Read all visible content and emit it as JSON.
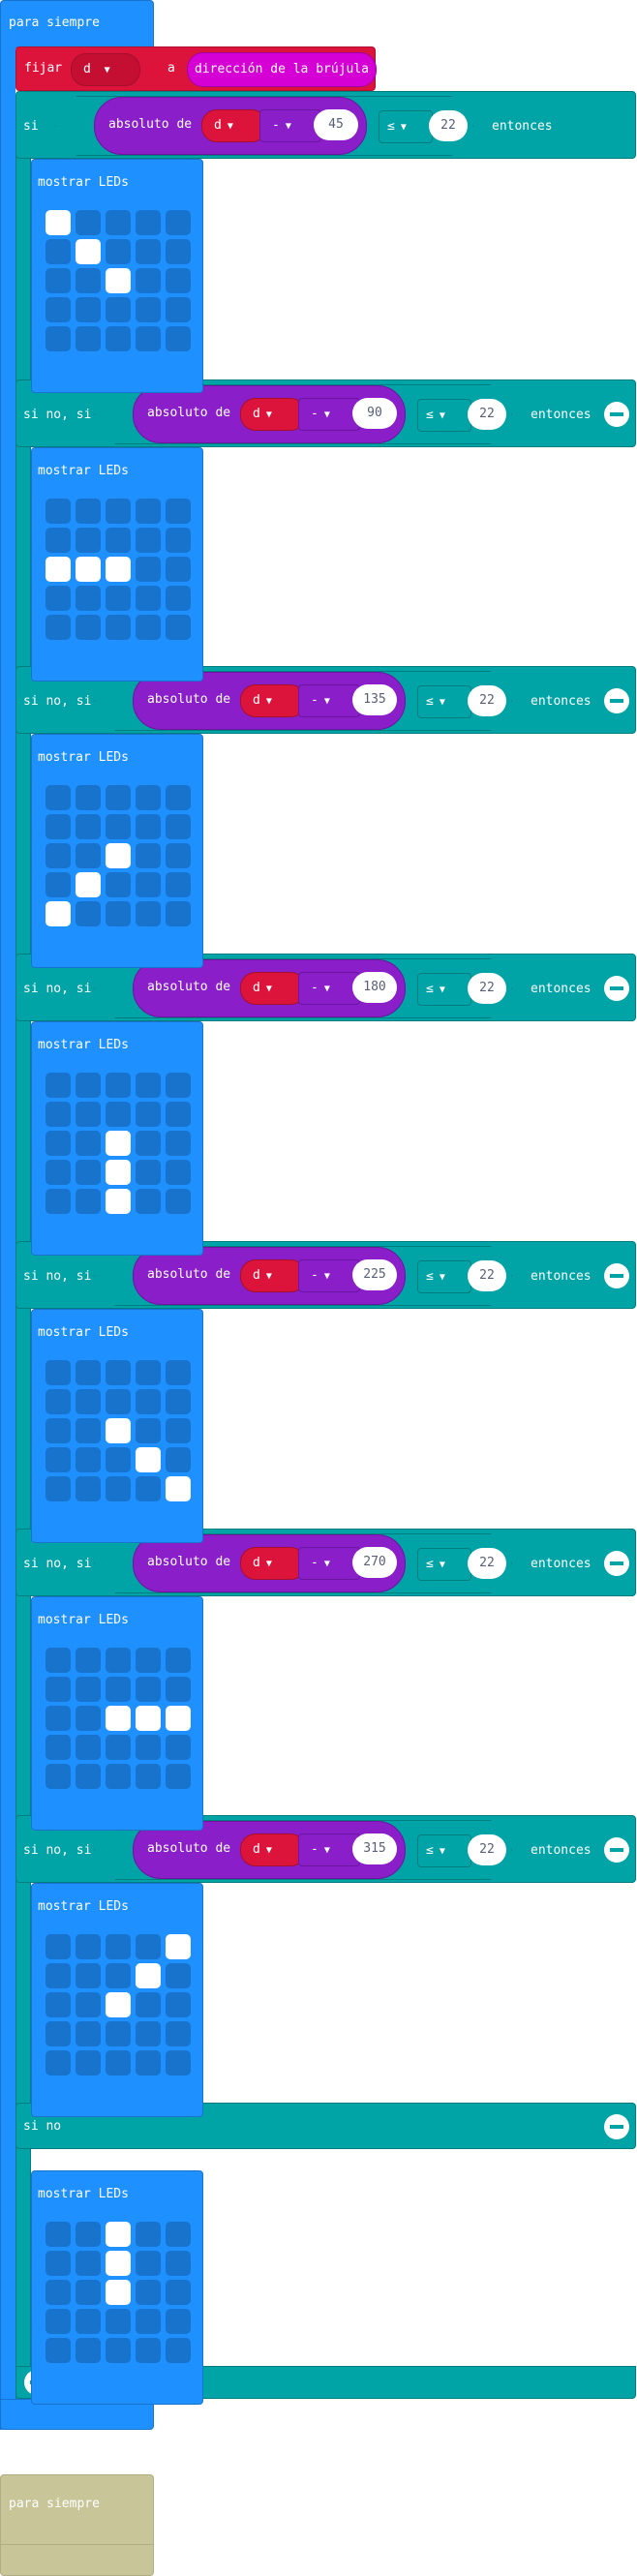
{
  "forever": {
    "label": "para siempre"
  },
  "set_block": {
    "label": "fijar",
    "variable": "d",
    "to_label": "a",
    "sensor_label": "dirección de la brújula (°)"
  },
  "if_keyword": "si",
  "elseif_keyword": "si no, si",
  "else_keyword": "si no",
  "then_keyword": "entonces",
  "condition": {
    "abs_label": "absoluto de",
    "variable": "d",
    "operator": "-",
    "compare_op": "≤",
    "threshold": "22"
  },
  "angles": [
    "45",
    "90",
    "135",
    "180",
    "225",
    "270",
    "315"
  ],
  "show_leds_label": "mostrar LEDs",
  "led_patterns": [
    [
      [
        1,
        0,
        0,
        0,
        0
      ],
      [
        0,
        1,
        0,
        0,
        0
      ],
      [
        0,
        0,
        1,
        0,
        0
      ],
      [
        0,
        0,
        0,
        0,
        0
      ],
      [
        0,
        0,
        0,
        0,
        0
      ]
    ],
    [
      [
        0,
        0,
        0,
        0,
        0
      ],
      [
        0,
        0,
        0,
        0,
        0
      ],
      [
        1,
        1,
        1,
        0,
        0
      ],
      [
        0,
        0,
        0,
        0,
        0
      ],
      [
        0,
        0,
        0,
        0,
        0
      ]
    ],
    [
      [
        0,
        0,
        0,
        0,
        0
      ],
      [
        0,
        0,
        0,
        0,
        0
      ],
      [
        0,
        0,
        1,
        0,
        0
      ],
      [
        0,
        1,
        0,
        0,
        0
      ],
      [
        1,
        0,
        0,
        0,
        0
      ]
    ],
    [
      [
        0,
        0,
        0,
        0,
        0
      ],
      [
        0,
        0,
        0,
        0,
        0
      ],
      [
        0,
        0,
        1,
        0,
        0
      ],
      [
        0,
        0,
        1,
        0,
        0
      ],
      [
        0,
        0,
        1,
        0,
        0
      ]
    ],
    [
      [
        0,
        0,
        0,
        0,
        0
      ],
      [
        0,
        0,
        0,
        0,
        0
      ],
      [
        0,
        0,
        1,
        0,
        0
      ],
      [
        0,
        0,
        0,
        1,
        0
      ],
      [
        0,
        0,
        0,
        0,
        1
      ]
    ],
    [
      [
        0,
        0,
        0,
        0,
        0
      ],
      [
        0,
        0,
        0,
        0,
        0
      ],
      [
        0,
        0,
        1,
        1,
        1
      ],
      [
        0,
        0,
        0,
        0,
        0
      ],
      [
        0,
        0,
        0,
        0,
        0
      ]
    ],
    [
      [
        0,
        0,
        0,
        0,
        1
      ],
      [
        0,
        0,
        0,
        1,
        0
      ],
      [
        0,
        0,
        1,
        0,
        0
      ],
      [
        0,
        0,
        0,
        0,
        0
      ],
      [
        0,
        0,
        0,
        0,
        0
      ]
    ],
    [
      [
        0,
        0,
        1,
        0,
        0
      ],
      [
        0,
        0,
        1,
        0,
        0
      ],
      [
        0,
        0,
        1,
        0,
        0
      ],
      [
        0,
        0,
        0,
        0,
        0
      ],
      [
        0,
        0,
        0,
        0,
        0
      ]
    ]
  ],
  "disabled_forever": {
    "label": "para siempre"
  },
  "colors": {
    "loops": "#1e90ff",
    "variables": "#dc143c",
    "logic": "#00a4a6",
    "math": "#8a1ec9",
    "input": "#d400d4",
    "disabled": "#c8c699"
  },
  "icons": {
    "remove_branch": "minus-circle-icon",
    "add_branch": "plus-circle-icon"
  }
}
